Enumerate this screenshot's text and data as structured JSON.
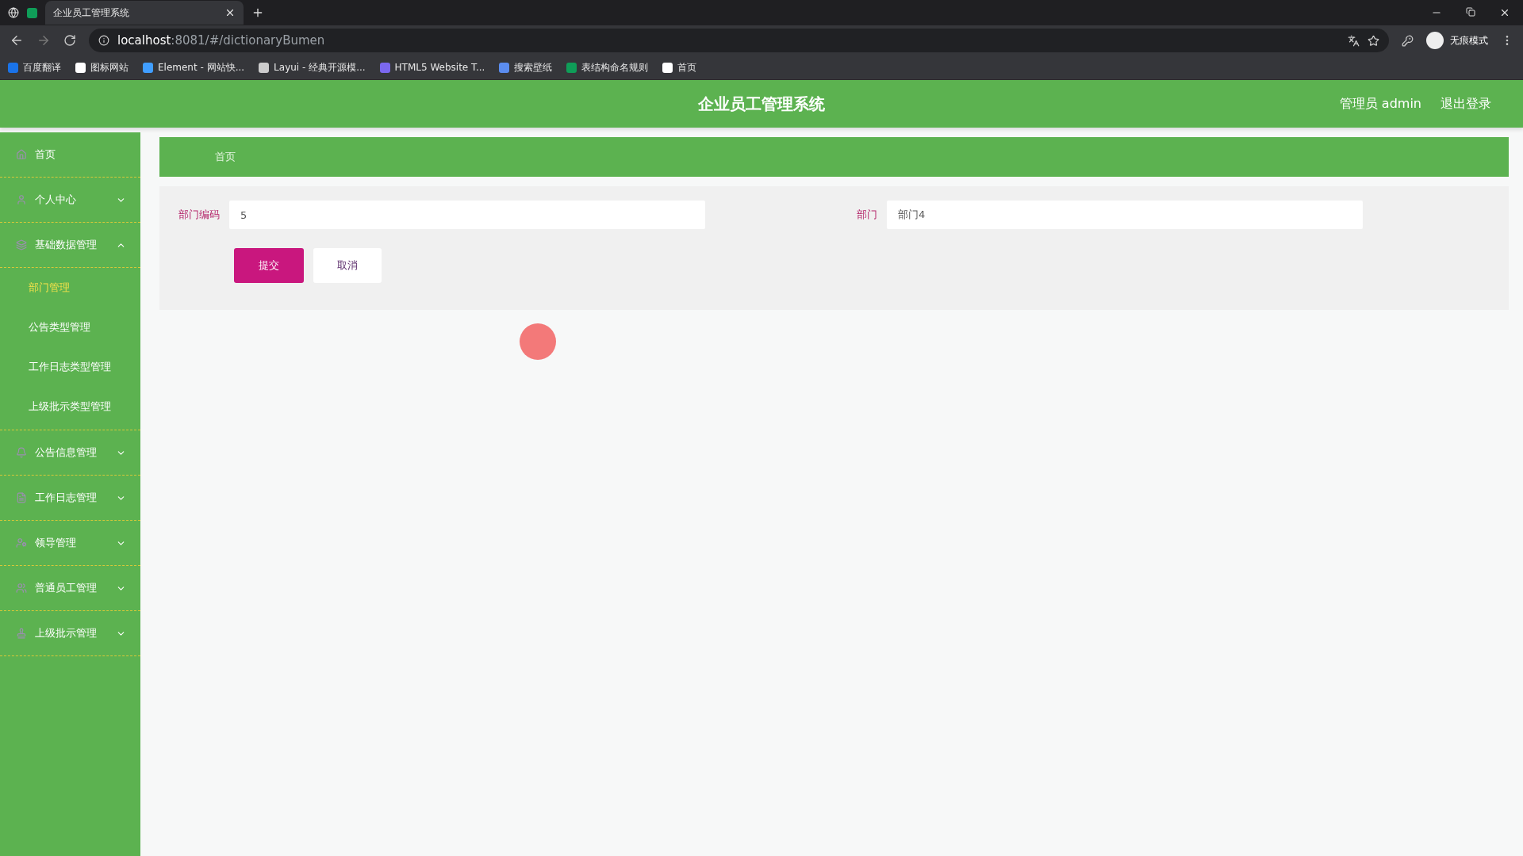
{
  "browser": {
    "tabs": [
      {
        "title": "企业员工管理系统",
        "selected": true
      }
    ],
    "url": {
      "host": "localhost",
      "rest": ":8081/#/dictionaryBumen"
    },
    "bookmarks": [
      {
        "label": "百度翻译",
        "color": "#1a73e8"
      },
      {
        "label": "图标网站",
        "color": "#ffffff"
      },
      {
        "label": "Element - 网站快...",
        "color": "#409eff"
      },
      {
        "label": "Layui - 经典开源模...",
        "color": "#cccccc"
      },
      {
        "label": "HTML5 Website T...",
        "color": "#7b68ee"
      },
      {
        "label": "搜索壁纸",
        "color": "#5b8def"
      },
      {
        "label": "表结构命名规则",
        "color": "#0f9d58"
      },
      {
        "label": "首页",
        "color": "#ffffff"
      }
    ],
    "profile": "无痕模式"
  },
  "header": {
    "title": "企业员工管理系统",
    "user": "管理员 admin",
    "logout": "退出登录"
  },
  "sidebar": {
    "items": [
      {
        "label": "首页",
        "kind": "link"
      },
      {
        "label": "个人中心",
        "kind": "menu",
        "expanded": false
      },
      {
        "label": "基础数据管理",
        "kind": "menu",
        "expanded": true,
        "children": [
          {
            "label": "部门管理",
            "selected": true
          },
          {
            "label": "公告类型管理",
            "selected": false
          },
          {
            "label": "工作日志类型管理",
            "selected": false
          },
          {
            "label": "上级批示类型管理",
            "selected": false
          }
        ]
      },
      {
        "label": "公告信息管理",
        "kind": "menu",
        "expanded": false
      },
      {
        "label": "工作日志管理",
        "kind": "menu",
        "expanded": false
      },
      {
        "label": "领导管理",
        "kind": "menu",
        "expanded": false
      },
      {
        "label": "普通员工管理",
        "kind": "menu",
        "expanded": false
      },
      {
        "label": "上级批示管理",
        "kind": "menu",
        "expanded": false
      }
    ]
  },
  "breadcrumb": "首页",
  "form": {
    "fields": [
      {
        "label": "部门编码",
        "value": "5"
      },
      {
        "label": "部门",
        "value": "部门4"
      }
    ],
    "buttons": [
      {
        "label": "提交",
        "kind": "primary"
      },
      {
        "label": "取消",
        "kind": "plain"
      }
    ]
  }
}
